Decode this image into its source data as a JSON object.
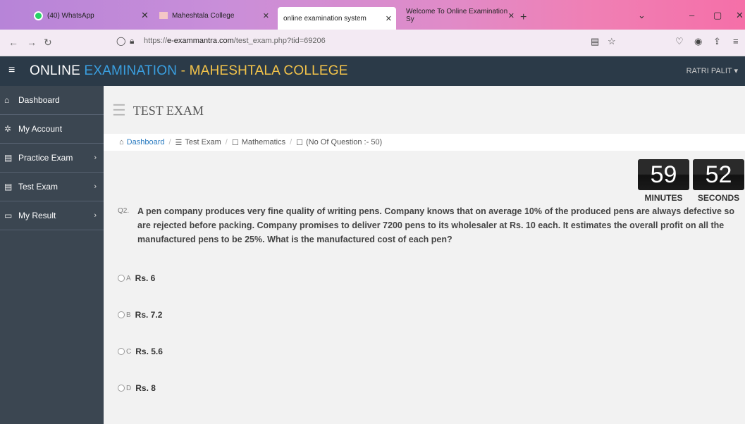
{
  "browser": {
    "tabs": [
      {
        "label": "(40) WhatsApp",
        "active": false
      },
      {
        "label": "Maheshtala College",
        "active": false
      },
      {
        "label": "online examination system",
        "active": true
      },
      {
        "label": "Welcome To Online Examination Sy",
        "active": false
      }
    ],
    "url_prefix": "https://",
    "url_domain": "e-exammantra.com",
    "url_path": "/test_exam.php?tid=69206"
  },
  "header": {
    "title_part1": "ONLINE ",
    "title_part2": "EXAMINATION",
    "title_part3": " - MAHESHTALA COLLEGE",
    "user": "RATRI PALIT"
  },
  "sidebar": {
    "items": [
      {
        "label": "Dashboard",
        "icon": "home-icon",
        "glyph": "⌂"
      },
      {
        "label": "My Account",
        "icon": "gear-icon",
        "glyph": "✲"
      },
      {
        "label": "Practice Exam",
        "icon": "document-icon",
        "glyph": "▤"
      },
      {
        "label": "Test Exam",
        "icon": "document-icon",
        "glyph": "▤"
      },
      {
        "label": "My Result",
        "icon": "monitor-icon",
        "glyph": "▭"
      }
    ]
  },
  "page": {
    "title": "TEST EXAM",
    "breadcrumb": {
      "dashboard": "Dashboard",
      "test_exam": "Test Exam",
      "subject": "Mathematics",
      "count": "(No Of Question :- 50)"
    }
  },
  "timer": {
    "minutes": "59",
    "minutes_label": "MINUTES",
    "seconds": "52",
    "seconds_label": "SECONDS"
  },
  "question": {
    "number": "Q2.",
    "text": "A pen company produces very fine quality of writing pens. Company knows that on average 10% of the produced pens are always defective so are rejected before packing. Company promises to deliver 7200 pens to its wholesaler at Rs. 10 each. It estimates the overall profit on all the manufactured pens to be 25%. What is the manufactured cost of each pen?",
    "options": [
      {
        "letter": "A",
        "text": "Rs. 6"
      },
      {
        "letter": "B",
        "text": "Rs. 7.2"
      },
      {
        "letter": "C",
        "text": "Rs. 5.6"
      },
      {
        "letter": "D",
        "text": "Rs. 8"
      }
    ]
  }
}
